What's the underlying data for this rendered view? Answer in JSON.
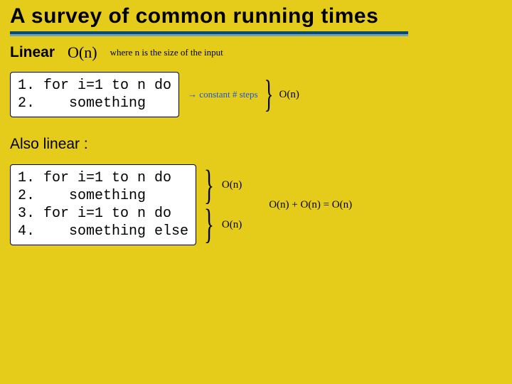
{
  "title": "A survey of common running times",
  "linear_label": "Linear",
  "big_o_n": "O(n)",
  "where_note": "where n is the size of the input",
  "code1": "1. for i=1 to n do\n2.    something",
  "arrow_note": "→ constant # steps",
  "on_right_1": "O(n)",
  "also_label": "Also linear :",
  "code2": "1. for i=1 to n do\n2.    something\n3. for i=1 to n do\n4.    something else",
  "on_top": "O(n)",
  "on_bottom": "O(n)",
  "sum_eq": "O(n) + O(n) = O(n)"
}
